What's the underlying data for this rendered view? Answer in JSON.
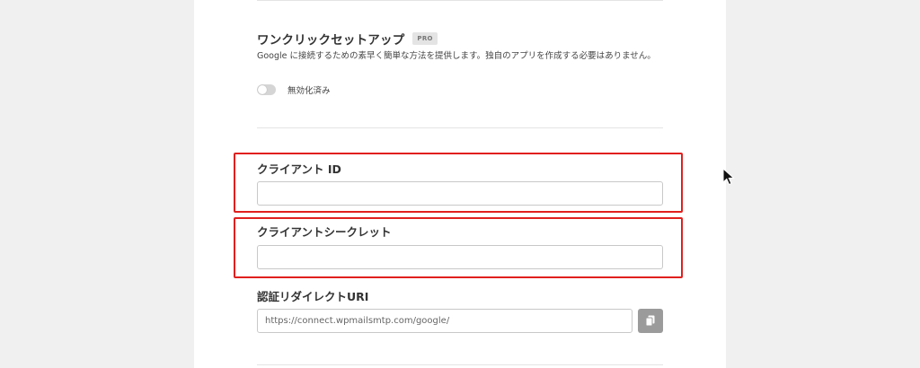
{
  "one_click": {
    "title": "ワンクリックセットアップ",
    "badge": "PRO",
    "description": "Google に接続するための素早く簡単な方法を提供します。独自のアプリを作成する必要はありません。",
    "toggle_label": "無効化済み",
    "toggle_on": false
  },
  "client_id": {
    "label": "クライアント ID",
    "value": ""
  },
  "client_secret": {
    "label": "クライアントシークレット",
    "value": ""
  },
  "redirect_uri": {
    "label": "認証リダイレクトURI",
    "value": "https://connect.wpmailsmtp.com/google/"
  },
  "colors": {
    "highlight": "#e0201e",
    "copy_button": "#9b9b9b"
  },
  "icons": {
    "copy": "copy-icon",
    "cursor": "mouse-pointer-icon"
  }
}
